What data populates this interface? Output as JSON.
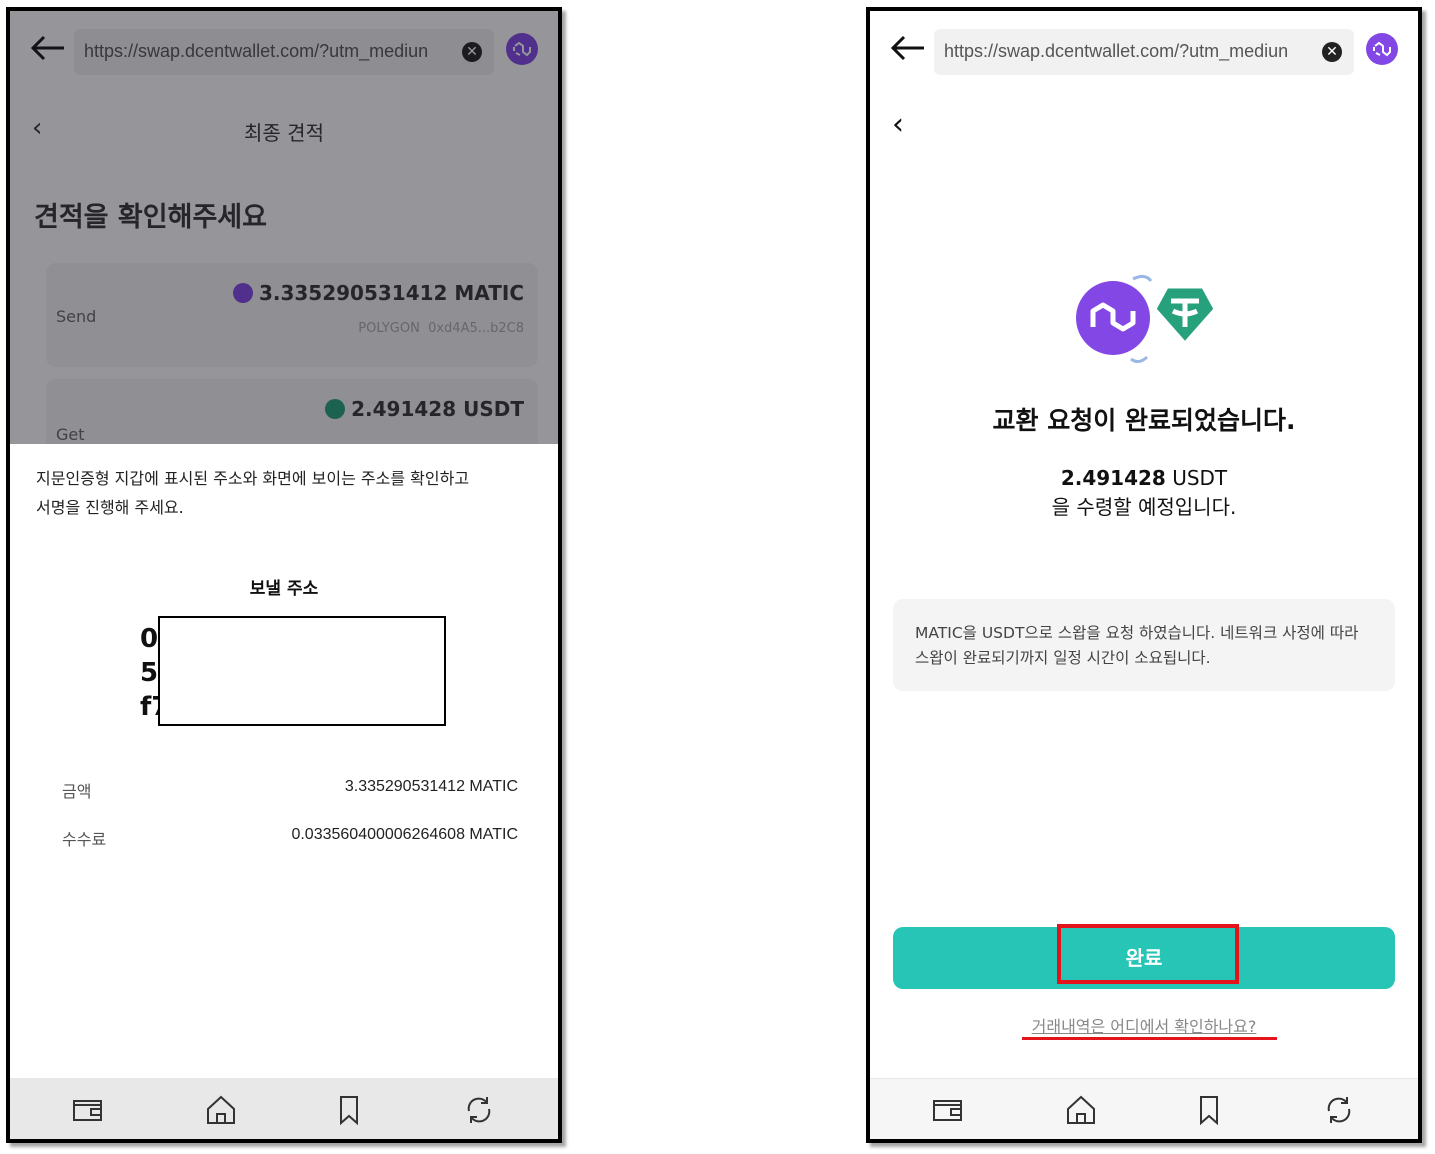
{
  "browser": {
    "url": "https://swap.dcentwallet.com/?utm_mediun",
    "clear_icon": "close-circle-icon",
    "network_icon": "polygon-icon"
  },
  "left_screen": {
    "header_title": "최종 견적",
    "heading": "견적을 확인해주세요",
    "send": {
      "label": "Send",
      "amount": "3.335290531412 MATIC",
      "network": "POLYGON",
      "address": "0xd4A5...b2C8"
    },
    "get": {
      "label": "Get",
      "amount": "2.491428 USDT"
    },
    "sheet": {
      "message_line1": "지문인증형 지갑에 표시된 주소와 화면에 보이는 주소를 확인하고",
      "message_line2": "서명을 진행해 주세요.",
      "address_label": "보낼 주소",
      "address_lines": [
        "0",
        "5",
        "f7"
      ],
      "amount_label": "금액",
      "amount_value": "3.335290531412 MATIC",
      "fee_label": "수수료",
      "fee_value": "0.033560400006264608 MATIC"
    }
  },
  "right_screen": {
    "title": "교환 요청이 완료되었습니다.",
    "receive_amount": "2.491428",
    "receive_unit": " USDT",
    "receive_line2": "을 수령할 예정입니다.",
    "info_text": "MATIC을 USDT으로 스왑을 요청 하였습니다. 네트워크 사정에 따라 스왑이 완료되기까지 일정 시간이 소요됩니다.",
    "done_button": "완료",
    "history_link": "거래내역은 어디에서 확인하나요?"
  },
  "nav_icons": [
    "wallet-icon",
    "home-icon",
    "bookmark-icon",
    "refresh-icon"
  ],
  "colors": {
    "accent": "#27c5b5",
    "polygon": "#8247e5",
    "tether": "#26a17b",
    "highlight": "#e3141b"
  }
}
